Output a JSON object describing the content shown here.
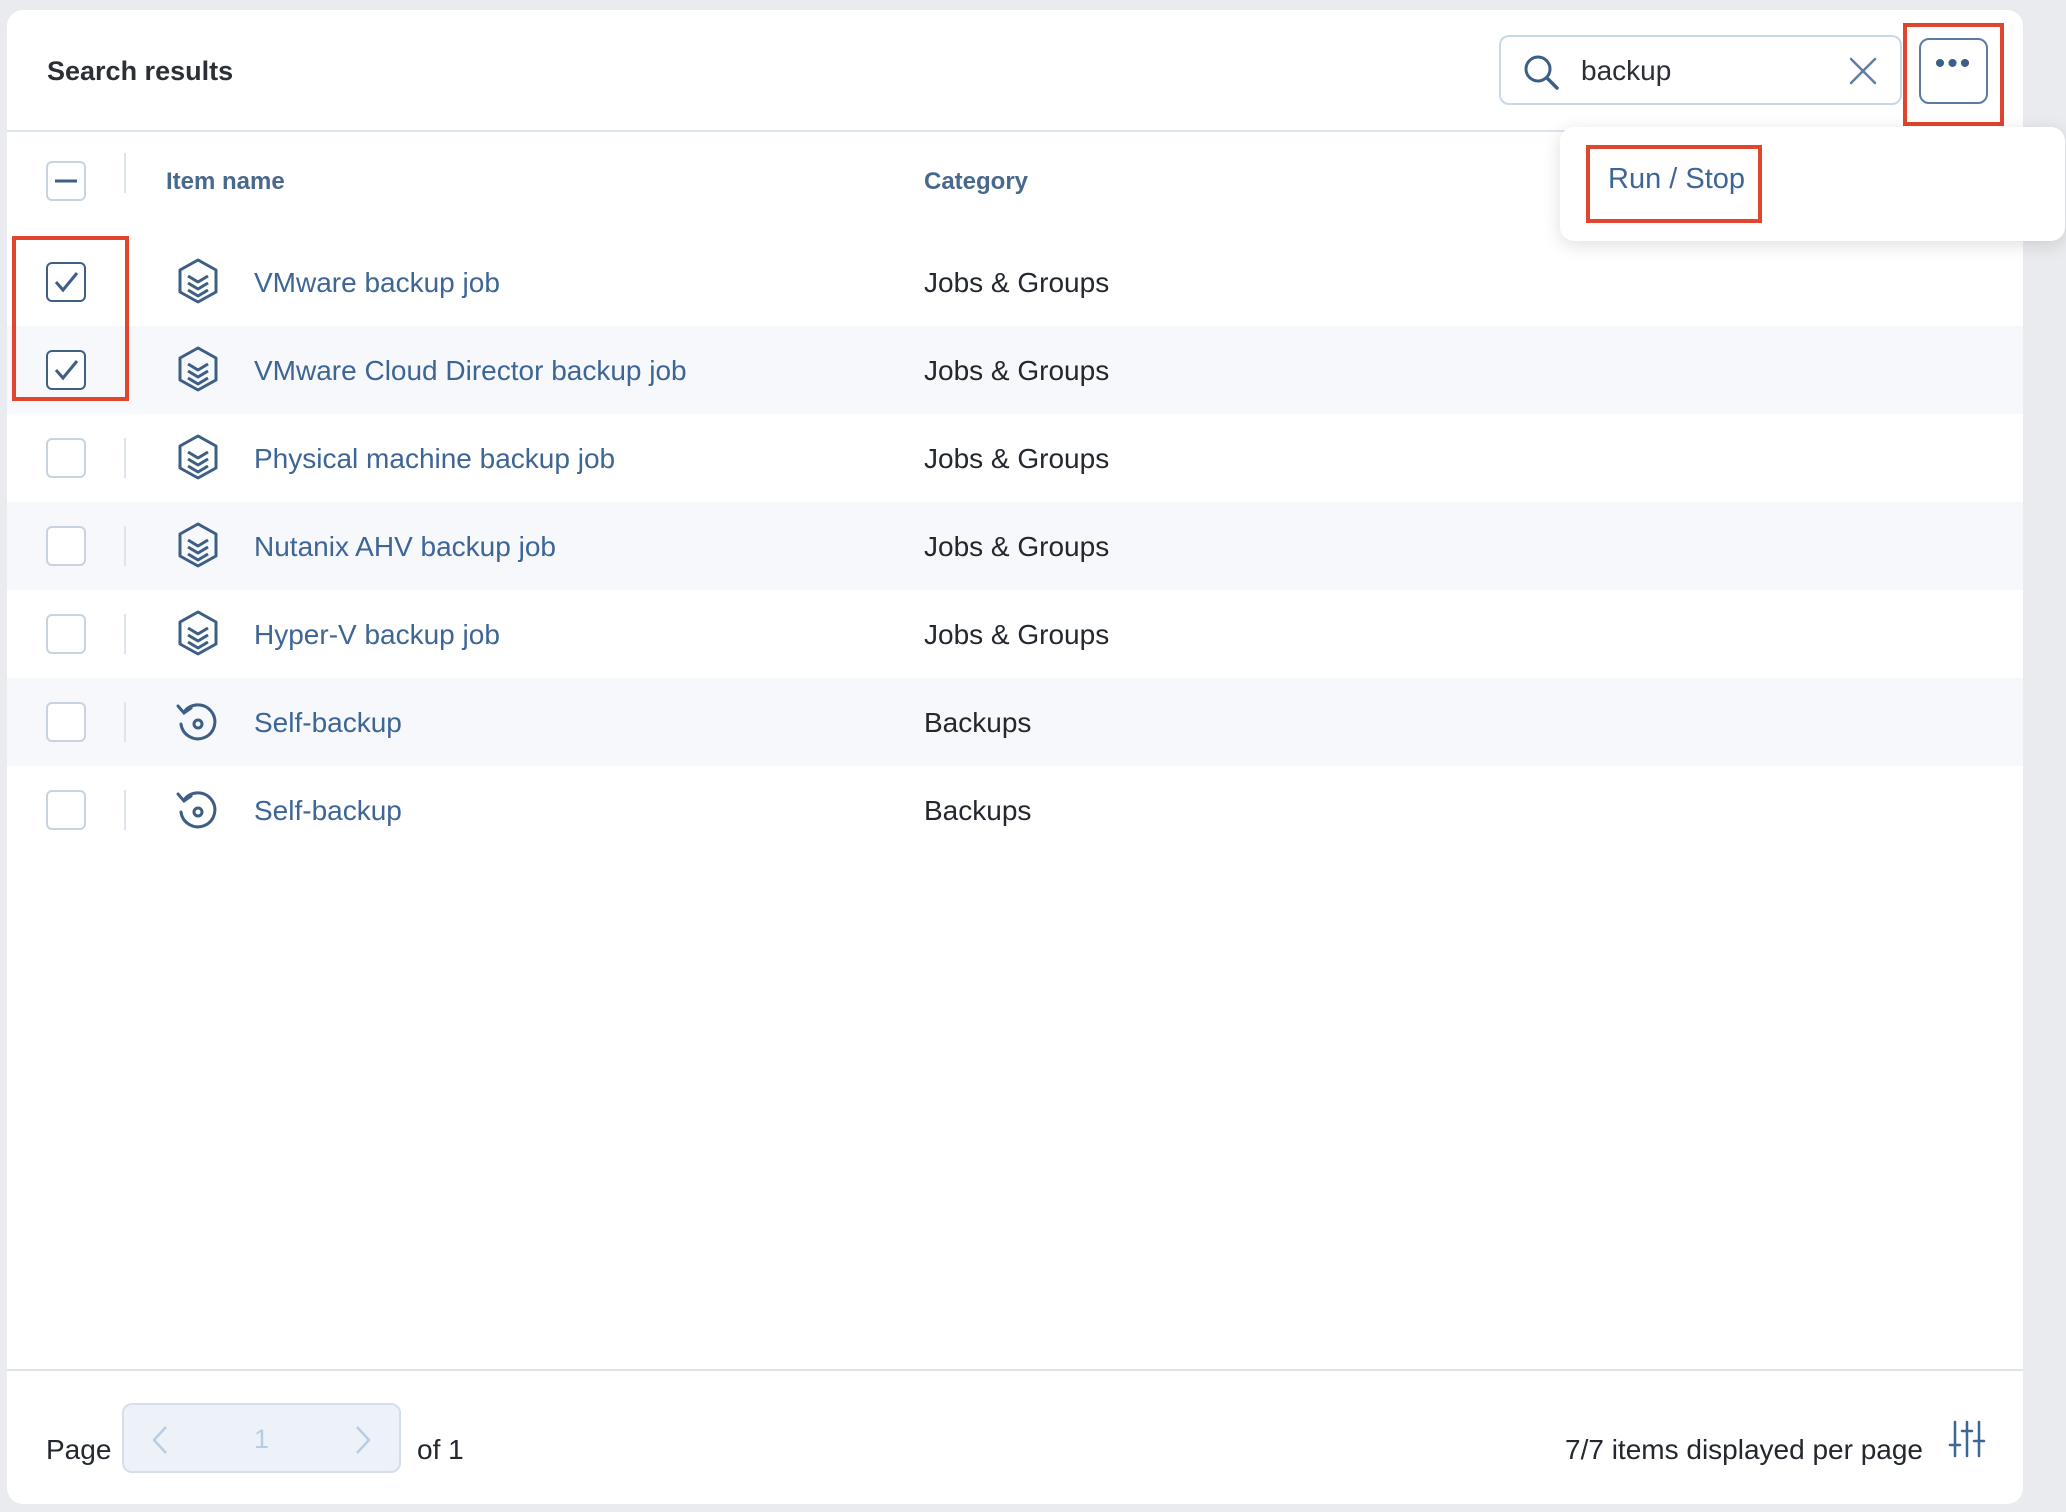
{
  "header": {
    "title": "Search results"
  },
  "search": {
    "value": "backup",
    "placeholder": ""
  },
  "more_menu": {
    "button_label": "•••",
    "items": [
      {
        "label": "Run / Stop"
      }
    ]
  },
  "table": {
    "columns": [
      "Item name",
      "Category"
    ],
    "rows": [
      {
        "checked": true,
        "icon": "job-layers-icon",
        "name": "VMware backup job",
        "category": "Jobs & Groups"
      },
      {
        "checked": true,
        "icon": "job-layers-icon",
        "name": "VMware Cloud Director backup job",
        "category": "Jobs & Groups"
      },
      {
        "checked": false,
        "icon": "job-layers-icon",
        "name": "Physical machine backup job",
        "category": "Jobs & Groups"
      },
      {
        "checked": false,
        "icon": "job-layers-icon",
        "name": "Nutanix AHV backup job",
        "category": "Jobs & Groups"
      },
      {
        "checked": false,
        "icon": "job-layers-icon",
        "name": "Hyper-V backup job",
        "category": "Jobs & Groups"
      },
      {
        "checked": false,
        "icon": "restore-icon",
        "name": "Self-backup",
        "category": "Backups"
      },
      {
        "checked": false,
        "icon": "restore-icon",
        "name": "Self-backup",
        "category": "Backups"
      }
    ]
  },
  "footer": {
    "page_label": "Page",
    "current_page": "1",
    "of_label": "of 1",
    "items_per_page": "7/7 items displayed per page"
  },
  "colors": {
    "accent": "#3d6595",
    "highlight": "#e0452d",
    "text": "#23272e"
  }
}
